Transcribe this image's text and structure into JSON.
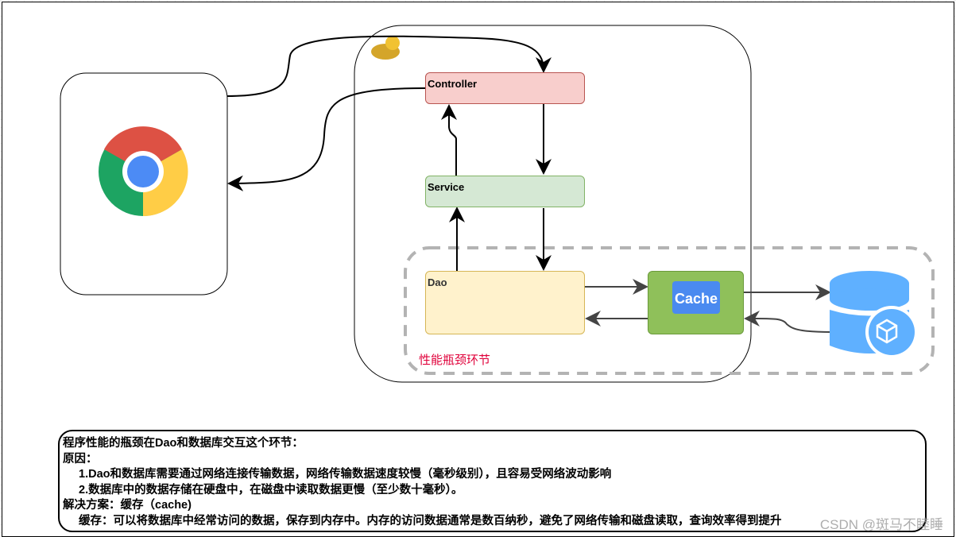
{
  "nodes": {
    "controller": "Controller",
    "service": "Service",
    "dao": "Dao",
    "cache": "Cache"
  },
  "bottleneck_label": "性能瓶颈环节",
  "note": {
    "lines": [
      "程序性能的瓶颈在Dao和数据库交互这个环节：",
      "原因：",
      "1.Dao和数据库需要通过网络连接传输数据，网络传输数据速度较慢（毫秒级别），且容易受网络波动影响",
      "2.数据库中的数据存储在硬盘中，在磁盘中读取数据更慢（至少数十毫秒）。",
      "解决方案：缓存（cache)",
      "缓存：可以将数据库中经常访问的数据，保存到内存中。内存的访问数据通常是数百纳秒，避免了网络传输和磁盘读取，查询效率得到提升"
    ]
  },
  "watermark": "CSDN @斑马不睦睡",
  "colors": {
    "controller": "#f8cecc",
    "service": "#d5e8d4",
    "dao": "#fff2cc",
    "cache": "#8fc05a",
    "database": "#5fb0ff",
    "label": "#e0003a"
  }
}
